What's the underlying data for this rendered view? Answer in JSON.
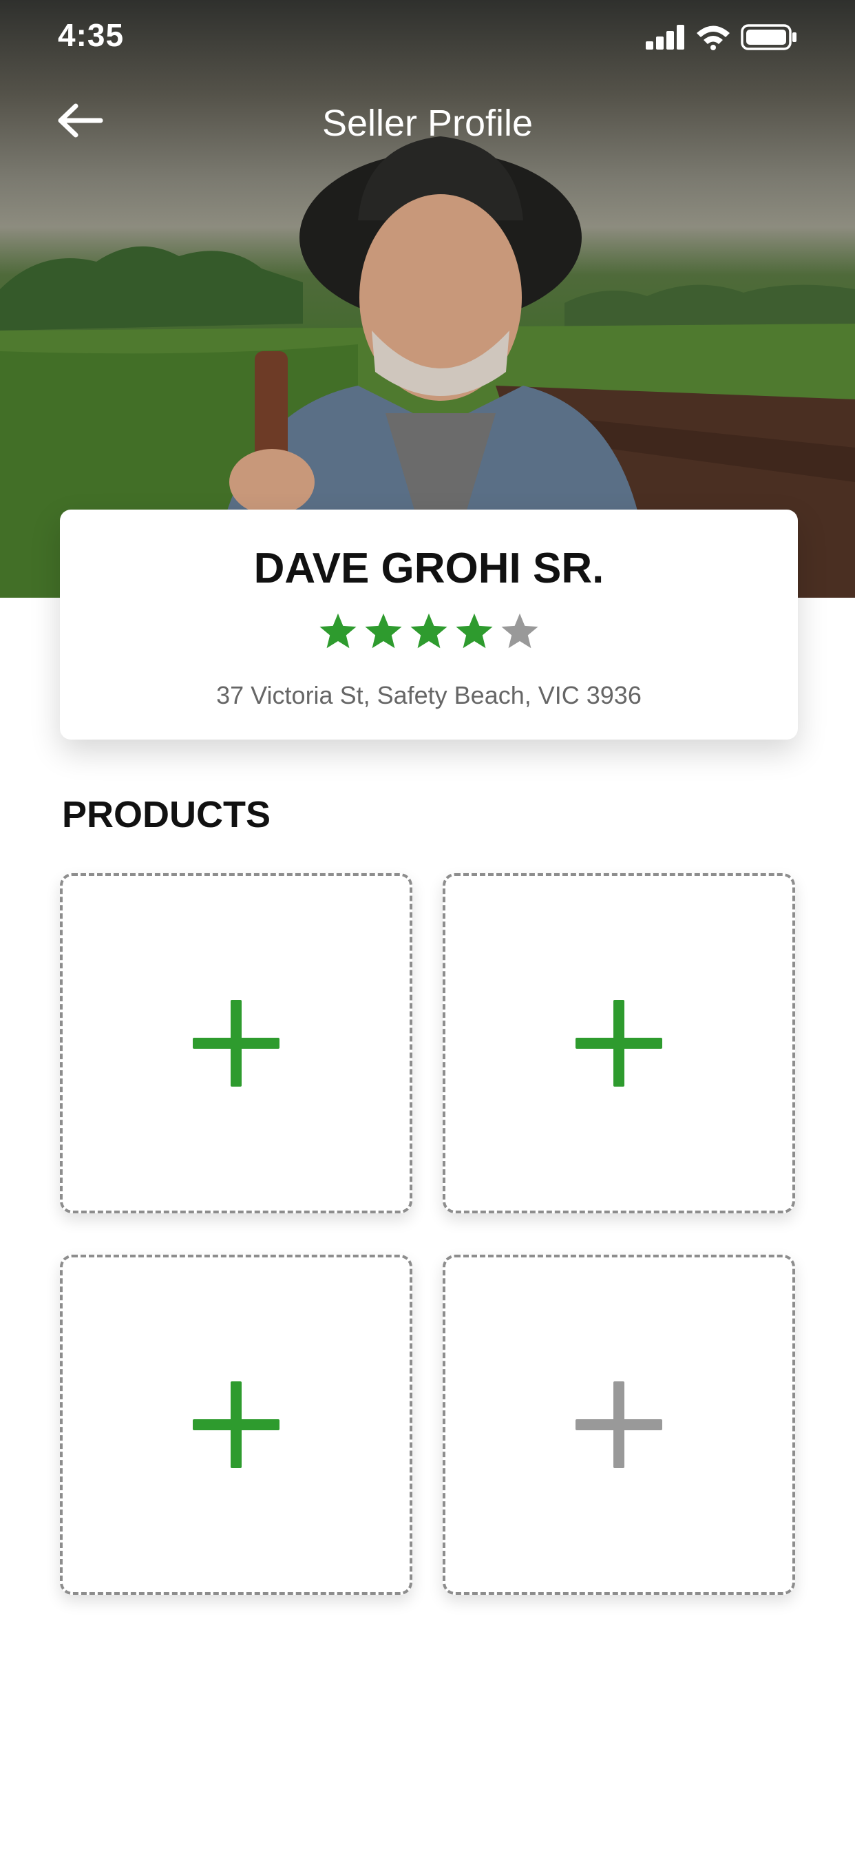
{
  "status_bar": {
    "time": "4:35"
  },
  "header": {
    "title": "Seller Profile"
  },
  "seller": {
    "name": "DAVE GROHI SR.",
    "rating": 4,
    "rating_max": 5,
    "address": "37 Victoria St, Safety Beach, VIC 3936"
  },
  "products": {
    "title": "PRODUCTS",
    "slots": [
      {
        "icon": "plus-icon",
        "active": true
      },
      {
        "icon": "plus-icon",
        "active": true
      },
      {
        "icon": "plus-icon",
        "active": true
      },
      {
        "icon": "plus-icon",
        "active": false
      }
    ]
  },
  "colors": {
    "accent": "#2e9b2e",
    "inactive": "#999999"
  }
}
